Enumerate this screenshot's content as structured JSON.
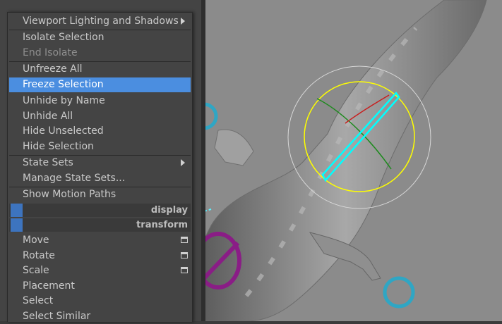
{
  "menu": {
    "items": [
      {
        "label": "Viewport Lighting and Shadows",
        "disabled": false,
        "submenu": true
      },
      {
        "label": "Isolate Selection",
        "disabled": false
      },
      {
        "label": "End Isolate",
        "disabled": true
      },
      {
        "label": "Unfreeze All",
        "disabled": false
      },
      {
        "label": "Freeze Selection",
        "disabled": false,
        "highlighted": true
      },
      {
        "label": "Unhide by Name",
        "disabled": false
      },
      {
        "label": "Unhide All",
        "disabled": false
      },
      {
        "label": "Hide Unselected",
        "disabled": false
      },
      {
        "label": "Hide Selection",
        "disabled": false
      },
      {
        "label": "State Sets",
        "disabled": false,
        "submenu": true
      },
      {
        "label": "Manage State Sets...",
        "disabled": false
      },
      {
        "label": "Show Motion Paths",
        "disabled": false
      }
    ],
    "sections": [
      {
        "label": "display"
      },
      {
        "label": "transform"
      }
    ],
    "transform_items": [
      {
        "label": "Move",
        "option_box": true
      },
      {
        "label": "Rotate",
        "option_box": true
      },
      {
        "label": "Scale",
        "option_box": true
      },
      {
        "label": "Placement"
      },
      {
        "label": "Select"
      },
      {
        "label": "Select Similar"
      }
    ]
  },
  "colors": {
    "menu_bg": "#444444",
    "highlight": "#4b8ee0",
    "section_marker": "#3d74bf",
    "viewport_bg": "#8a8a8a",
    "manipulator_yellow": "#ffff00",
    "selection_cyan": "#00ffff",
    "rig_control_cyan": "#2fa6c4",
    "rig_control_magenta": "#8a1d86"
  },
  "icons": [
    "submenu-arrow-icon",
    "option-box-icon"
  ]
}
